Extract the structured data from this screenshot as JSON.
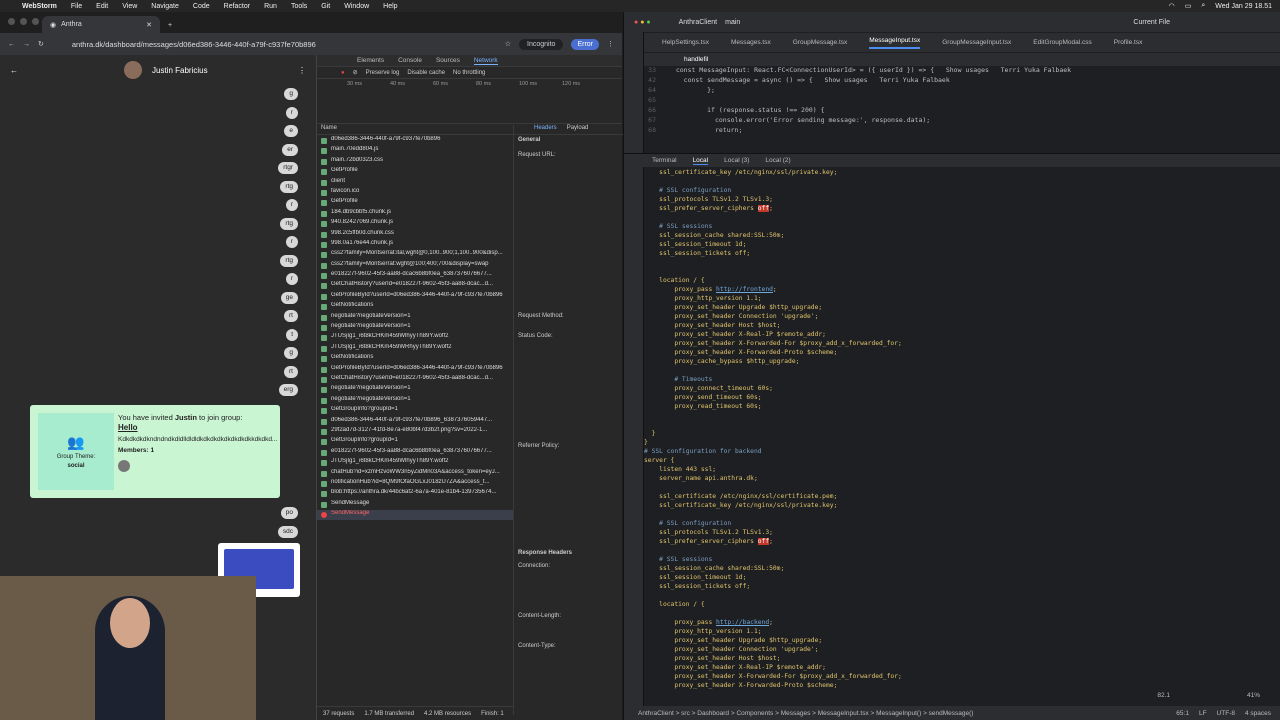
{
  "mac": {
    "app": "WebStorm",
    "menus": [
      "File",
      "Edit",
      "View",
      "Navigate",
      "Code",
      "Refactor",
      "Run",
      "Tools",
      "Git",
      "Window",
      "Help"
    ],
    "clock": "Wed Jan 29  18.51"
  },
  "browser": {
    "tab_title": "Anthra",
    "url": "anthra.dk/dashboard/messages/d06ed386-3446-440f-a79f-c937fe70b896",
    "incognito": "Incognito",
    "error": "Error"
  },
  "chat": {
    "contact": "Justin Fabricius",
    "bubbles": [
      "g",
      "r",
      "e",
      "er",
      "rtgr",
      "rtg",
      "r",
      "rtg",
      "r",
      "rtg",
      "r",
      "ge",
      "rt",
      "t",
      "g",
      "rt",
      "erg"
    ],
    "bubbles_low": [
      "po",
      "sdc"
    ],
    "invite": {
      "theme_label": "Group Theme:",
      "theme": "social",
      "pre": "You have invited ",
      "name": "Justin",
      "post": " to join group:",
      "group": "Hello",
      "desc": "Kdkdkdkdkndndndkdldlldldldkdkdkdkdkdkdkdkkdkdkd...",
      "members": "Members: 1"
    }
  },
  "devtools": {
    "tabs": [
      "Elements",
      "Console",
      "Sources",
      "Network"
    ],
    "active_tab": "Network",
    "toolbar": {
      "preserve": "Preserve log",
      "disable": "Disable cache",
      "throttle": "No throttling"
    },
    "ticks": [
      "30 ms",
      "40 ms",
      "60 ms",
      "80 ms",
      "100 ms",
      "120 ms"
    ],
    "list_header": "Name",
    "requests": [
      "d06ed386-3446-440f-a79f-c937fe70b896",
      "main.70edd804.js",
      "main.72bd0323.css",
      "GetProfile",
      "client",
      "favicon.ico",
      "GetProfile",
      "184.db9cbbf5.chunk.js",
      "940.82427069.chunk.js",
      "998.2c5ffb0d.chunk.css",
      "998.0a176e44.chunk.js",
      "css2?family=Montserrat:ital,wght@0,100..900;1,100..900&disp...",
      "css2?family=Montserrat:wght@100;400;700&display=swap",
      "e018227f-9602-45f3-aa88-dcac6b8bf0ea_6387376076677...",
      "GetChatHistory?userId=e018227f-9602-45f3-aa88-dcac...d...",
      "GetProfileById?userId=d06ed386-3446-440f-a79f-c937fe70b896",
      "GetNotifications",
      "negotiate?negotiateVersion=1",
      "negotiate?negotiateVersion=1",
      "JTUSjIg1_i6t8kCHKm459WlhyyTh89Y.woff2",
      "JTUSjIg1_i6t8kCHKm459WRhyyTh89Y.woff2",
      "GetNotifications",
      "GetProfileById?userId=d06ed386-3446-440f-a79f-c937fe70b896",
      "GetChatHistory?userId=e018227f-9602-45f3-aa88-dcac...d...",
      "negotiate?negotiateVersion=1",
      "negotiate?negotiateVersion=1",
      "GetGroupInfo?groupId=1",
      "d06ed386-3446-440f-a79f-c937fe70b896_6387376059447...",
      "29f2ad7d-3127-41fd-8e7a-e80bf47d3b2f.png?sv=2022-1...",
      "GetGroupInfo?groupId=1",
      "e018227f-9602-45f3-aa88-dcac6b8bf0ea_6387376076677...",
      "JTUSjIg1_i6t8kCHKm459WlhyyTh89Y.woff2",
      "chatHub?id=xzmHzvoWW3n5yZidMn03A&access_token=eyJ...",
      "notificationHub?id=8QM9fOfaOGLxJ018zU7ZA&access_t...",
      "blob:https://anthra.dk/44bc6af2-6a7a-401e-81b4-139735674...",
      "SendMessage",
      "SendMessage"
    ],
    "hdr_tabs": [
      "Headers",
      "Payload"
    ],
    "general": "General",
    "hdr_labels": {
      "url": "Request URL:",
      "method": "Request Method:",
      "status": "Status Code:",
      "referrer": "Referrer Policy:",
      "resp": "Response Headers",
      "conn": "Connection:",
      "len": "Content-Length:",
      "type": "Content-Type:"
    },
    "footer": {
      "requests": "37 requests",
      "transferred": "1.7 MB transferred",
      "resources": "4.2 MB resources",
      "finish": "Finish: 1"
    }
  },
  "ide": {
    "project": "AnthraClient",
    "branch": "main",
    "runcfg": "Current File",
    "tabs": [
      "HelpSettings.tsx",
      "Messages.tsx",
      "GroupMessage.tsx",
      "MessageInput.tsx",
      "GroupMessageInput.tsx",
      "EditGroupModal.css",
      "Profile.tsx"
    ],
    "active_tab": "MessageInput.tsx",
    "find": "handlefil",
    "code": [
      {
        "n": "33",
        "t": "  const MessageInput: React.FC<ConnectionUserId> = ({ userId }) => {   Show usages   Terri Yuka Falbaek"
      },
      {
        "n": "42",
        "t": "    const sendMessage = async () => {   Show usages   Terri Yuka Falbaek"
      },
      {
        "n": "64",
        "t": "          };"
      },
      {
        "n": "65",
        "t": ""
      },
      {
        "n": "66",
        "t": "          if (response.status !== 200) {"
      },
      {
        "n": "67",
        "t": "            console.error('Error sending message:', response.data);"
      },
      {
        "n": "68",
        "t": "            return;"
      }
    ],
    "term_tabs": [
      "Terminal",
      "Local",
      "Local (3)",
      "Local (2)"
    ],
    "status": {
      "crumbs": "AnthraClient  >  src  >  Dashboard  >  Components  >  Messages  >  MessageInput.tsx  >  MessageInput()  >  sendMessage()",
      "pos": "65:1",
      "lf": "LF",
      "enc": "UTF-8",
      "indent": "4 spaces"
    },
    "term_overlay": {
      "ratio": "82.1",
      "pct": "41%"
    }
  },
  "terminal_lines": [
    [
      "    ssl_certificate_key /etc/nginx/ssl/private.key;",
      ""
    ],
    [
      "",
      ""
    ],
    [
      "    # SSL configuration",
      "cm"
    ],
    [
      "    ssl_protocols TLSv1.2 TLSv1.3;",
      ""
    ],
    [
      "    ssl_prefer_server_ciphers off;",
      "off"
    ],
    [
      "",
      ""
    ],
    [
      "    # SSL sessions",
      "cm"
    ],
    [
      "    ssl_session_cache shared:SSL:50m;",
      ""
    ],
    [
      "    ssl_session_timeout 1d;",
      ""
    ],
    [
      "    ssl_session_tickets off;",
      ""
    ],
    [
      "",
      ""
    ],
    [
      "",
      ""
    ],
    [
      "    location / {",
      ""
    ],
    [
      "        proxy_pass http://frontend;",
      "lk"
    ],
    [
      "        proxy_http_version 1.1;",
      ""
    ],
    [
      "        proxy_set_header Upgrade $http_upgrade;",
      ""
    ],
    [
      "        proxy_set_header Connection 'upgrade';",
      ""
    ],
    [
      "        proxy_set_header Host $host;",
      ""
    ],
    [
      "        proxy_set_header X-Real-IP $remote_addr;",
      ""
    ],
    [
      "        proxy_set_header X-Forwarded-For $proxy_add_x_forwarded_for;",
      ""
    ],
    [
      "        proxy_set_header X-Forwarded-Proto $scheme;",
      ""
    ],
    [
      "        proxy_cache_bypass $http_upgrade;",
      ""
    ],
    [
      "",
      ""
    ],
    [
      "        # Timeouts",
      "cm"
    ],
    [
      "        proxy_connect_timeout 60s;",
      ""
    ],
    [
      "        proxy_send_timeout 60s;",
      ""
    ],
    [
      "        proxy_read_timeout 60s;",
      ""
    ],
    [
      "",
      ""
    ],
    [
      "",
      ""
    ],
    [
      "  }",
      ""
    ],
    [
      "}",
      ""
    ],
    [
      "# SSL configuration for backend",
      "cm"
    ],
    [
      "server {",
      ""
    ],
    [
      "    listen 443 ssl;",
      ""
    ],
    [
      "    server_name api.anthra.dk;",
      ""
    ],
    [
      "",
      ""
    ],
    [
      "    ssl_certificate /etc/nginx/ssl/certificate.pem;",
      ""
    ],
    [
      "    ssl_certificate_key /etc/nginx/ssl/private.key;",
      ""
    ],
    [
      "",
      ""
    ],
    [
      "    # SSL configuration",
      "cm"
    ],
    [
      "    ssl_protocols TLSv1.2 TLSv1.3;",
      ""
    ],
    [
      "    ssl_prefer_server_ciphers off;",
      "off"
    ],
    [
      "",
      ""
    ],
    [
      "    # SSL sessions",
      "cm"
    ],
    [
      "    ssl_session_cache shared:SSL:50m;",
      ""
    ],
    [
      "    ssl_session_timeout 1d;",
      ""
    ],
    [
      "    ssl_session_tickets off;",
      ""
    ],
    [
      "",
      ""
    ],
    [
      "    location / {",
      ""
    ],
    [
      "",
      ""
    ],
    [
      "        proxy_pass http://backend;",
      "lk"
    ],
    [
      "        proxy_http_version 1.1;",
      ""
    ],
    [
      "        proxy_set_header Upgrade $http_upgrade;",
      ""
    ],
    [
      "        proxy_set_header Connection 'upgrade';",
      ""
    ],
    [
      "        proxy_set_header Host $host;",
      ""
    ],
    [
      "        proxy_set_header X-Real-IP $remote_addr;",
      ""
    ],
    [
      "        proxy_set_header X-Forwarded-For $proxy_add_x_forwarded_for;",
      ""
    ],
    [
      "        proxy_set_header X-Forwarded-Proto $scheme;",
      ""
    ]
  ]
}
